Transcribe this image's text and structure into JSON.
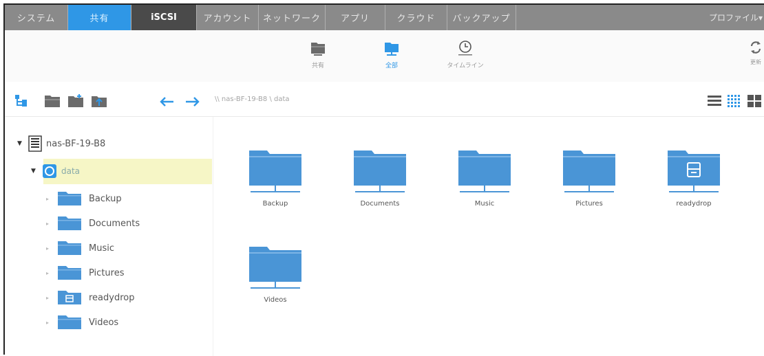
{
  "nav": {
    "tabs": [
      {
        "label": "システム"
      },
      {
        "label": "共有"
      },
      {
        "label": "iSCSI"
      },
      {
        "label": "アカウント"
      },
      {
        "label": "ネットワーク"
      },
      {
        "label": "アプリ"
      },
      {
        "label": "クラウド"
      },
      {
        "label": "バックアップ"
      }
    ],
    "profile": "プロファイル▾"
  },
  "toolbar": {
    "share_label": "共有",
    "all_label": "全部",
    "timeline_label": "タイムライン",
    "refresh_label": "更新"
  },
  "pathbar": {
    "path": "\\\\ nas-BF-19-B8 \\ data"
  },
  "tree": {
    "root": "nas-BF-19-B8",
    "volume": "data",
    "folders": [
      "Backup",
      "Documents",
      "Music",
      "Pictures",
      "readydrop",
      "Videos"
    ]
  },
  "main": {
    "items": [
      "Backup",
      "Documents",
      "Music",
      "Pictures",
      "readydrop",
      "Videos"
    ]
  },
  "colors": {
    "accent": "#2f97e6",
    "folder": "#4a95d6",
    "nav_bg": "#8a8a8a",
    "selected": "#f6f6c6"
  }
}
